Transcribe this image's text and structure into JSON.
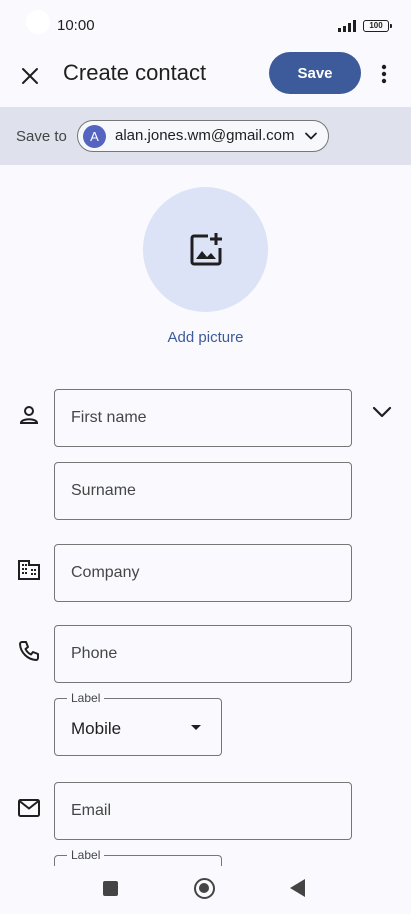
{
  "status_bar": {
    "time": "10:00",
    "battery": "100"
  },
  "app_bar": {
    "title": "Create contact",
    "save_label": "Save"
  },
  "save_to": {
    "label": "Save to",
    "avatar_letter": "A",
    "email": "alan.jones.wm@gmail.com"
  },
  "picture": {
    "label": "Add picture"
  },
  "fields": {
    "first_name": {
      "placeholder": "First name",
      "value": ""
    },
    "surname": {
      "placeholder": "Surname",
      "value": ""
    },
    "company": {
      "placeholder": "Company",
      "value": ""
    },
    "phone": {
      "placeholder": "Phone",
      "value": ""
    },
    "phone_label": {
      "caption": "Label",
      "value": "Mobile"
    },
    "email": {
      "placeholder": "Email",
      "value": ""
    },
    "email_label": {
      "caption": "Label"
    }
  },
  "colors": {
    "accent": "#3d5a9a",
    "avatar": "#5464c0",
    "picture_bg": "#dce3f7",
    "save_to_bg": "#dfe2ec"
  },
  "icons": [
    "close-icon",
    "more-vert-icon",
    "chevron-down-icon",
    "add-photo-icon",
    "person-icon",
    "expand-more-icon",
    "business-icon",
    "phone-icon",
    "email-icon",
    "dropdown-arrow-icon"
  ]
}
